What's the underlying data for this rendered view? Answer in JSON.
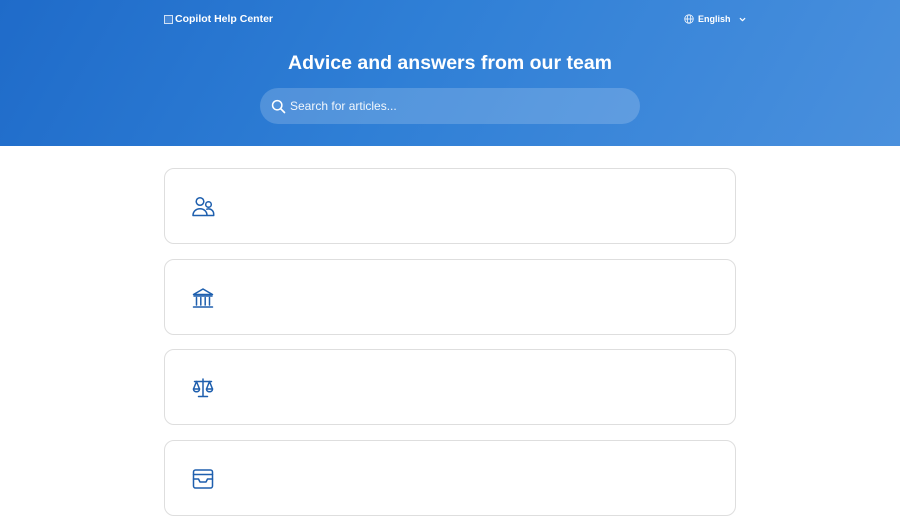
{
  "header": {
    "logo_text": "Copilot Help Center",
    "language_label": "English",
    "accent_color": "#2a78d3"
  },
  "hero": {
    "title": "Advice and answers from our team",
    "search_placeholder": "Search for articles..."
  },
  "collections": [
    {
      "icon": "people-icon"
    },
    {
      "icon": "bank-icon"
    },
    {
      "icon": "scales-icon"
    },
    {
      "icon": "inbox-icon"
    }
  ]
}
